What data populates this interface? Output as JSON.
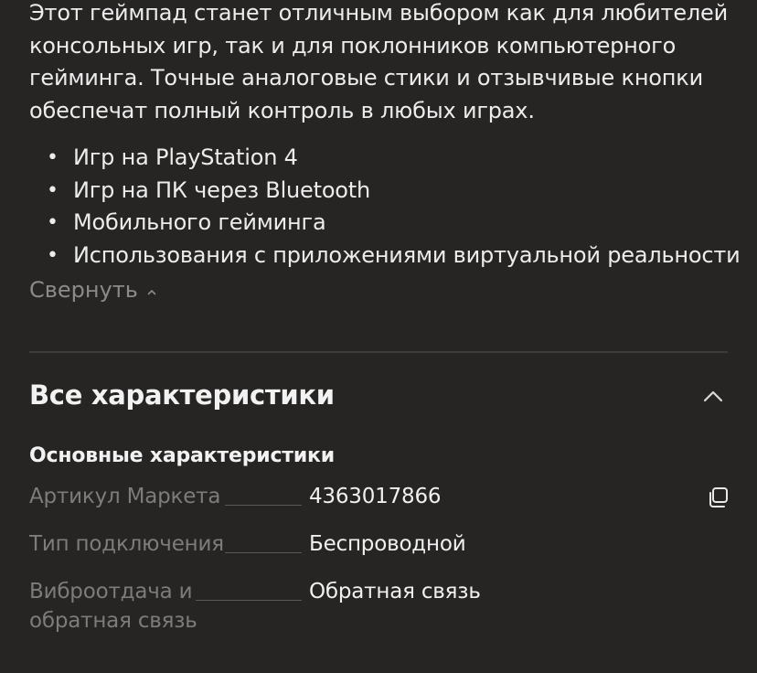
{
  "description": {
    "text": "Этот геймпад станет отличным выбором как для любителей консольных игр, так и для поклонников компьютерного гейминга. Точные аналоговые стики и отзывчивые кнопки обеспечат полный контроль в любых играх."
  },
  "use_cases": {
    "bullet_glyph": "•",
    "items": [
      "Игр на PlayStation 4",
      "Игр на ПК через Bluetooth",
      "Мобильного гейминга",
      "Использования с приложениями виртуальной реальности"
    ]
  },
  "collapse_label": "Свернуть",
  "specs_section": {
    "title": "Все характеристики",
    "group_title": "Основные характеристики",
    "rows": [
      {
        "label": "Артикул Маркета",
        "value": "4363017866"
      },
      {
        "label": "Тип подключения",
        "value": "Беспроводной"
      },
      {
        "label": "Виброотдача и обратная связь",
        "value": "Обратная связь"
      }
    ]
  },
  "icons": {
    "collapse": "chevron-up-icon",
    "section_toggle": "chevron-up-icon",
    "copy": "copy-icon"
  },
  "colors": {
    "background": "#262524",
    "text_primary": "#efefef",
    "text_secondary": "#7d7c7a",
    "divider": "#3d3c3a"
  }
}
